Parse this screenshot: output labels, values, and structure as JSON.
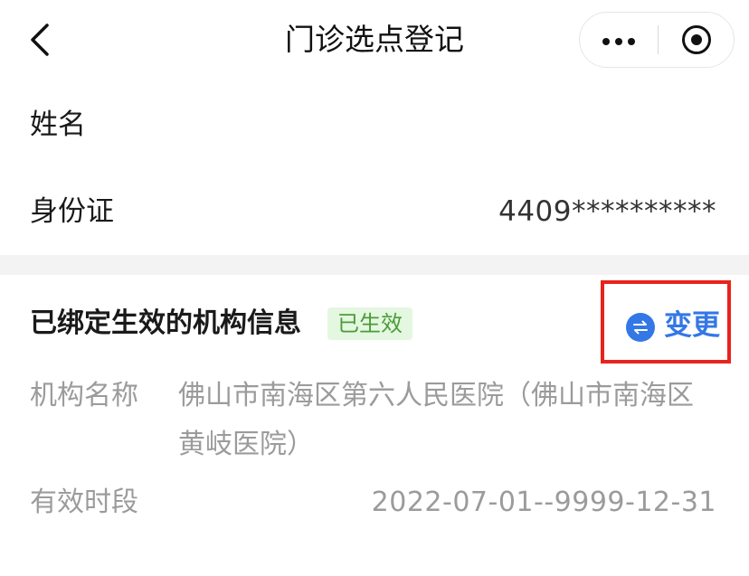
{
  "header": {
    "title": "门诊选点登记",
    "back_icon": "chevron-left-icon",
    "more_icon": "more-dots-icon",
    "close_icon": "target-circle-icon"
  },
  "person": {
    "name_label": "姓名",
    "name_value": "",
    "id_label": "身份证",
    "id_value": "4409**********"
  },
  "institution": {
    "section_title": "已绑定生效的机构信息",
    "status_badge": "已生效",
    "change_label": "变更",
    "change_icon": "swap-icon",
    "name_label": "机构名称",
    "name_value": "佛山市南海区第六人民医院（佛山市南海区黄岐医院）",
    "period_label": "有效时段",
    "period_value": "2022-07-01--9999-12-31"
  },
  "colors": {
    "accent_blue": "#3477e6",
    "badge_bg": "#e4f7e0",
    "badge_text": "#4b9b3a",
    "highlight_red": "#e8231c",
    "muted_text": "#9b9b9b"
  }
}
